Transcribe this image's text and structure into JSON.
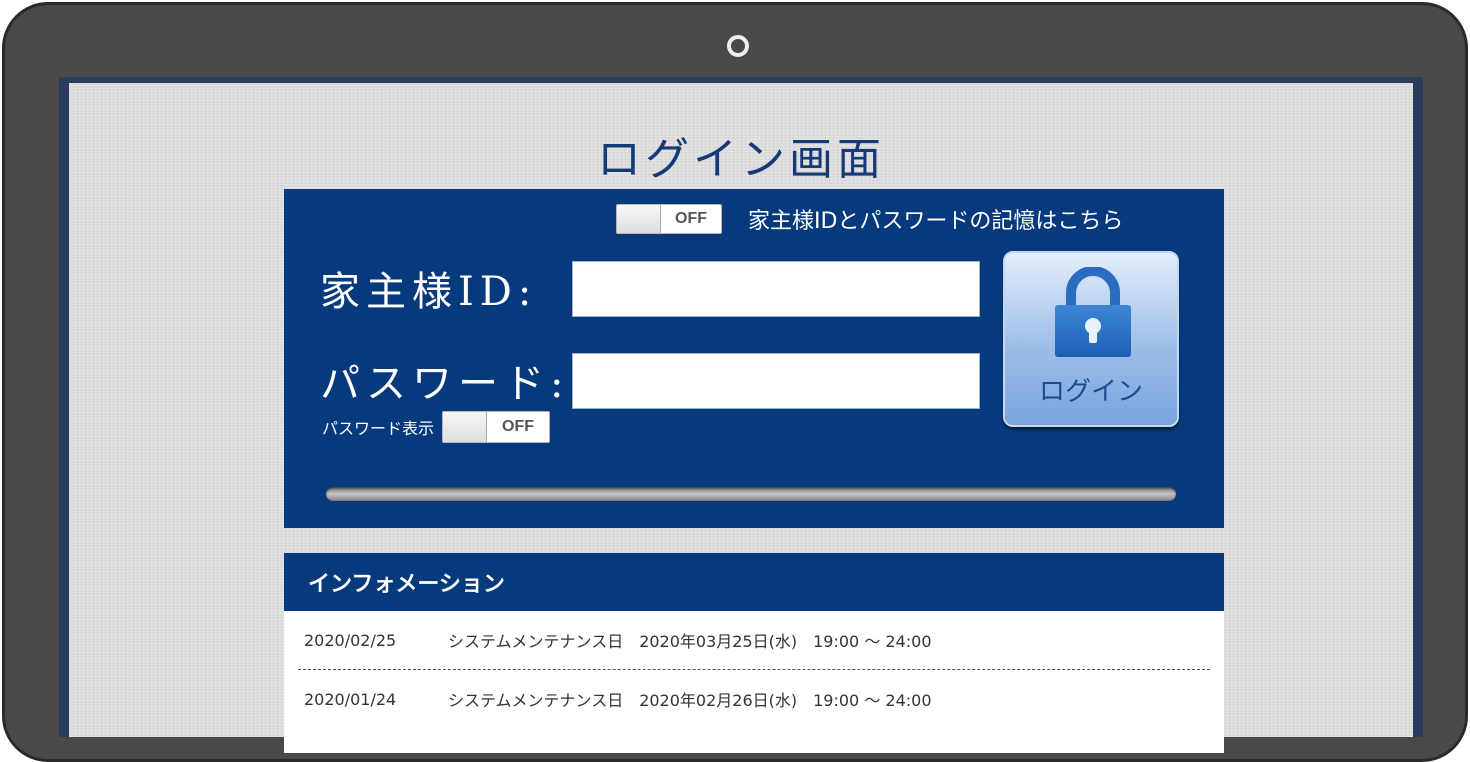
{
  "page_title": "ログイン画面",
  "remember": {
    "toggle_state": "OFF",
    "label": "家主様IDとパスワードの記憶はこちら"
  },
  "fields": {
    "id_label": "家主様ID:",
    "id_value": "",
    "password_label": "パスワード:",
    "password_value": ""
  },
  "show_password": {
    "label": "パスワード表示",
    "toggle_state": "OFF"
  },
  "login_button": {
    "label": "ログイン",
    "icon": "lock-icon"
  },
  "info": {
    "header": "インフォメーション",
    "items": [
      {
        "date": "2020/02/25",
        "text": "システムメンテナンス日　2020年03月25日(水)　19:00 ～ 24:00"
      },
      {
        "date": "2020/01/24",
        "text": "システムメンテナンス日　2020年02月26日(水)　19:00 ～ 24:00"
      }
    ]
  },
  "colors": {
    "panel": "#063a7c",
    "title": "#143a78",
    "button": "#9dbde8"
  }
}
